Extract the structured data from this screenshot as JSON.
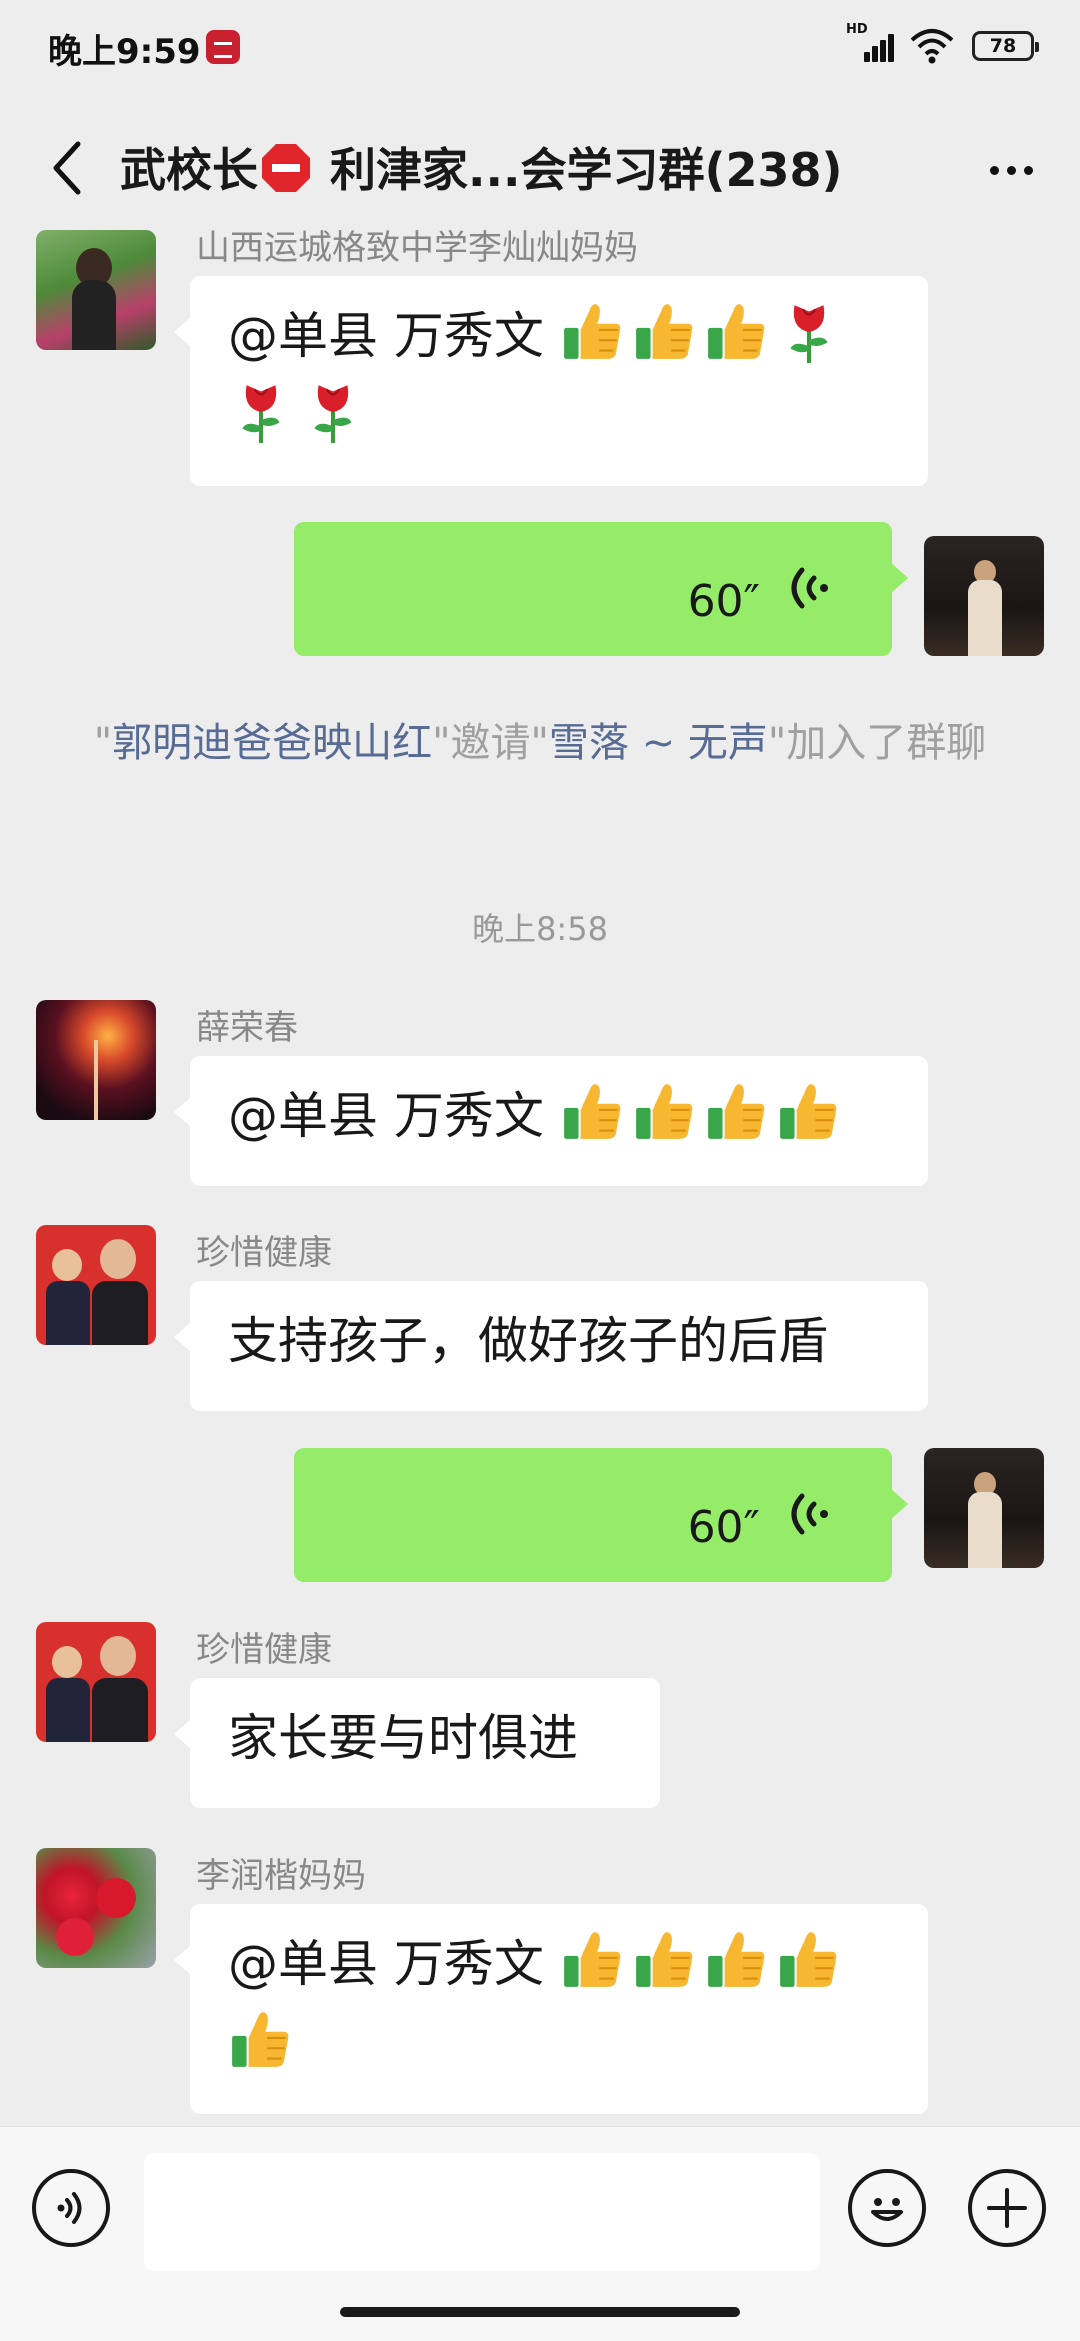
{
  "status_bar": {
    "time": "晚上9:59",
    "network": "HD",
    "battery": "78"
  },
  "nav": {
    "title_prefix": "武校长",
    "title_suffix": "利津家...会学习群(238)"
  },
  "messages": [
    {
      "sender": "山西运城格致中学李灿灿妈妈",
      "text": "@单县  万秀文 ",
      "emoji": [
        "thumbs-up",
        "thumbs-up",
        "thumbs-up",
        "rose",
        "rose",
        "rose"
      ]
    },
    {
      "self": true,
      "voice_duration": "60″"
    },
    {
      "system": {
        "inviter": "郭明迪爸爸映山红",
        "verb": "邀请",
        "invitee": "雪落 ~ 无声",
        "tail": "加入了群聊"
      }
    },
    {
      "timestamp": "晚上8:58"
    },
    {
      "sender": "薛荣春",
      "text": "@单县  万秀文 ",
      "emoji": [
        "thumbs-up",
        "thumbs-up",
        "thumbs-up",
        "thumbs-up"
      ]
    },
    {
      "sender": "珍惜健康",
      "text": "支持孩子，做好孩子的后盾"
    },
    {
      "self": true,
      "voice_duration": "60″"
    },
    {
      "sender": "珍惜健康",
      "text": "家长要与时俱进"
    },
    {
      "sender": "李润楷妈妈",
      "text": "@单县  万秀文 ",
      "emoji": [
        "thumbs-up",
        "thumbs-up",
        "thumbs-up",
        "thumbs-up",
        "thumbs-up"
      ]
    }
  ],
  "input": {
    "value": "",
    "placeholder": ""
  },
  "colors": {
    "background": "#ededed",
    "self_bubble": "#95ec69",
    "link_name": "#576b95",
    "stop_sign": "#e0262a"
  }
}
